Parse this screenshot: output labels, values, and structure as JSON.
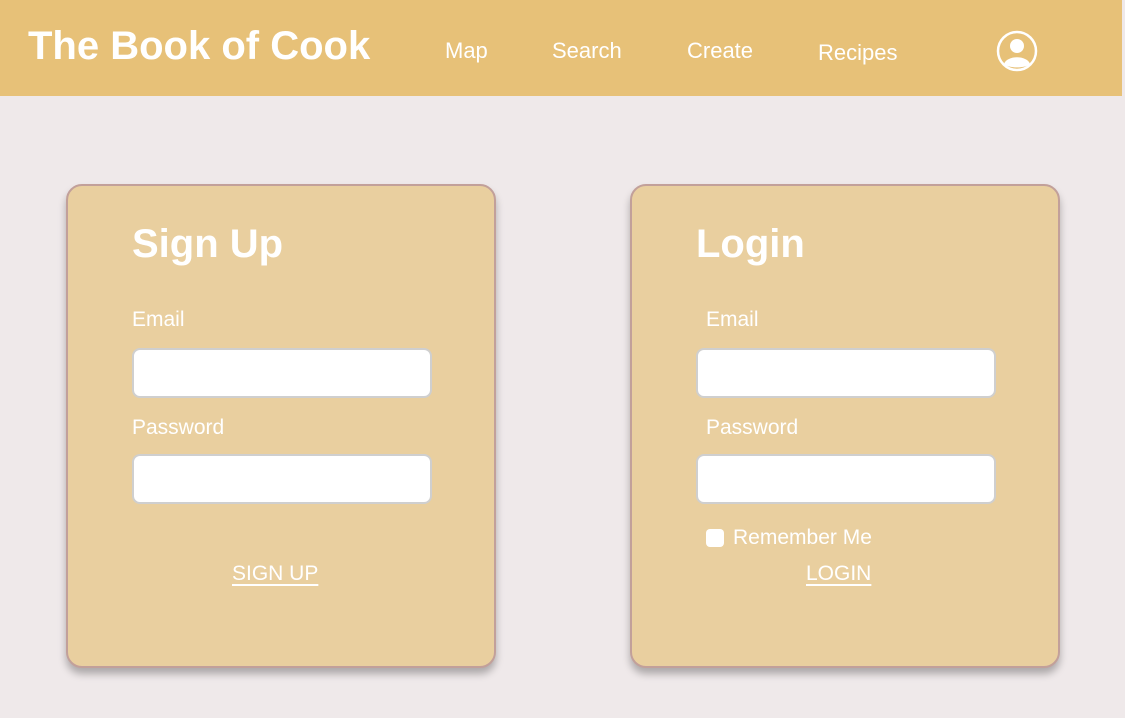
{
  "header": {
    "brand": "The Book of Cook",
    "nav": [
      "Map",
      "Search",
      "Create",
      "Recipes"
    ],
    "profile_icon": "user-circle-icon"
  },
  "signup": {
    "title": "Sign Up",
    "email_label": "Email",
    "email_value": "",
    "password_label": "Password",
    "password_value": "",
    "submit_label": "SIGN UP"
  },
  "login": {
    "title": "Login",
    "email_label": "Email",
    "email_value": "",
    "password_label": "Password",
    "password_value": "",
    "remember_label": "Remember Me",
    "remember_checked": false,
    "submit_label": "LOGIN"
  },
  "colors": {
    "header_bg": "#e7c178",
    "page_bg": "#efe9ea",
    "card_bg": "#e9cf9f",
    "card_border": "#c2a09a",
    "text": "#ffffff"
  }
}
